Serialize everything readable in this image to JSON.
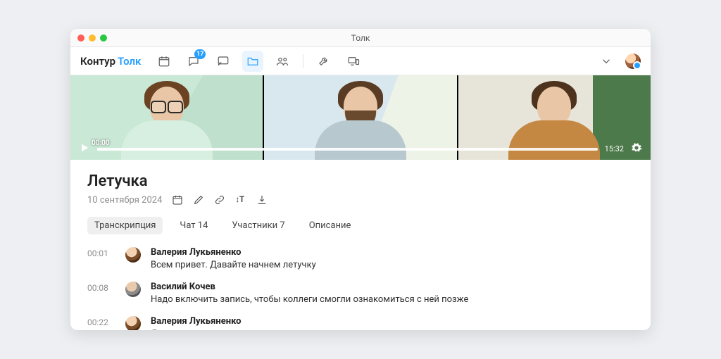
{
  "window": {
    "title": "Толк"
  },
  "brand": {
    "part1": "Контур",
    "part2": "Толк"
  },
  "toolbar": {
    "chat_badge": "17"
  },
  "video": {
    "start_time": "00:00",
    "end_time": "15:32"
  },
  "meeting": {
    "title": "Летучка",
    "date": "10 сентября 2024"
  },
  "tabs": {
    "transcription": "Транскрипция",
    "chat": "Чат 14",
    "participants": "Участники 7",
    "description": "Описание"
  },
  "transcript": [
    {
      "ts": "00:01",
      "avatar": "a1",
      "name": "Валерия Лукьяненко",
      "text": "Всем привет. Давайте начнем летучку"
    },
    {
      "ts": "00:08",
      "avatar": "a2",
      "name": "Василий Кочев",
      "text": "Надо включить запись, чтобы коллеги смогли ознакомиться с ней позже"
    },
    {
      "ts": "00:22",
      "avatar": "a1",
      "name": "Валерия Лукьяненко",
      "text": "Да, уже"
    }
  ]
}
